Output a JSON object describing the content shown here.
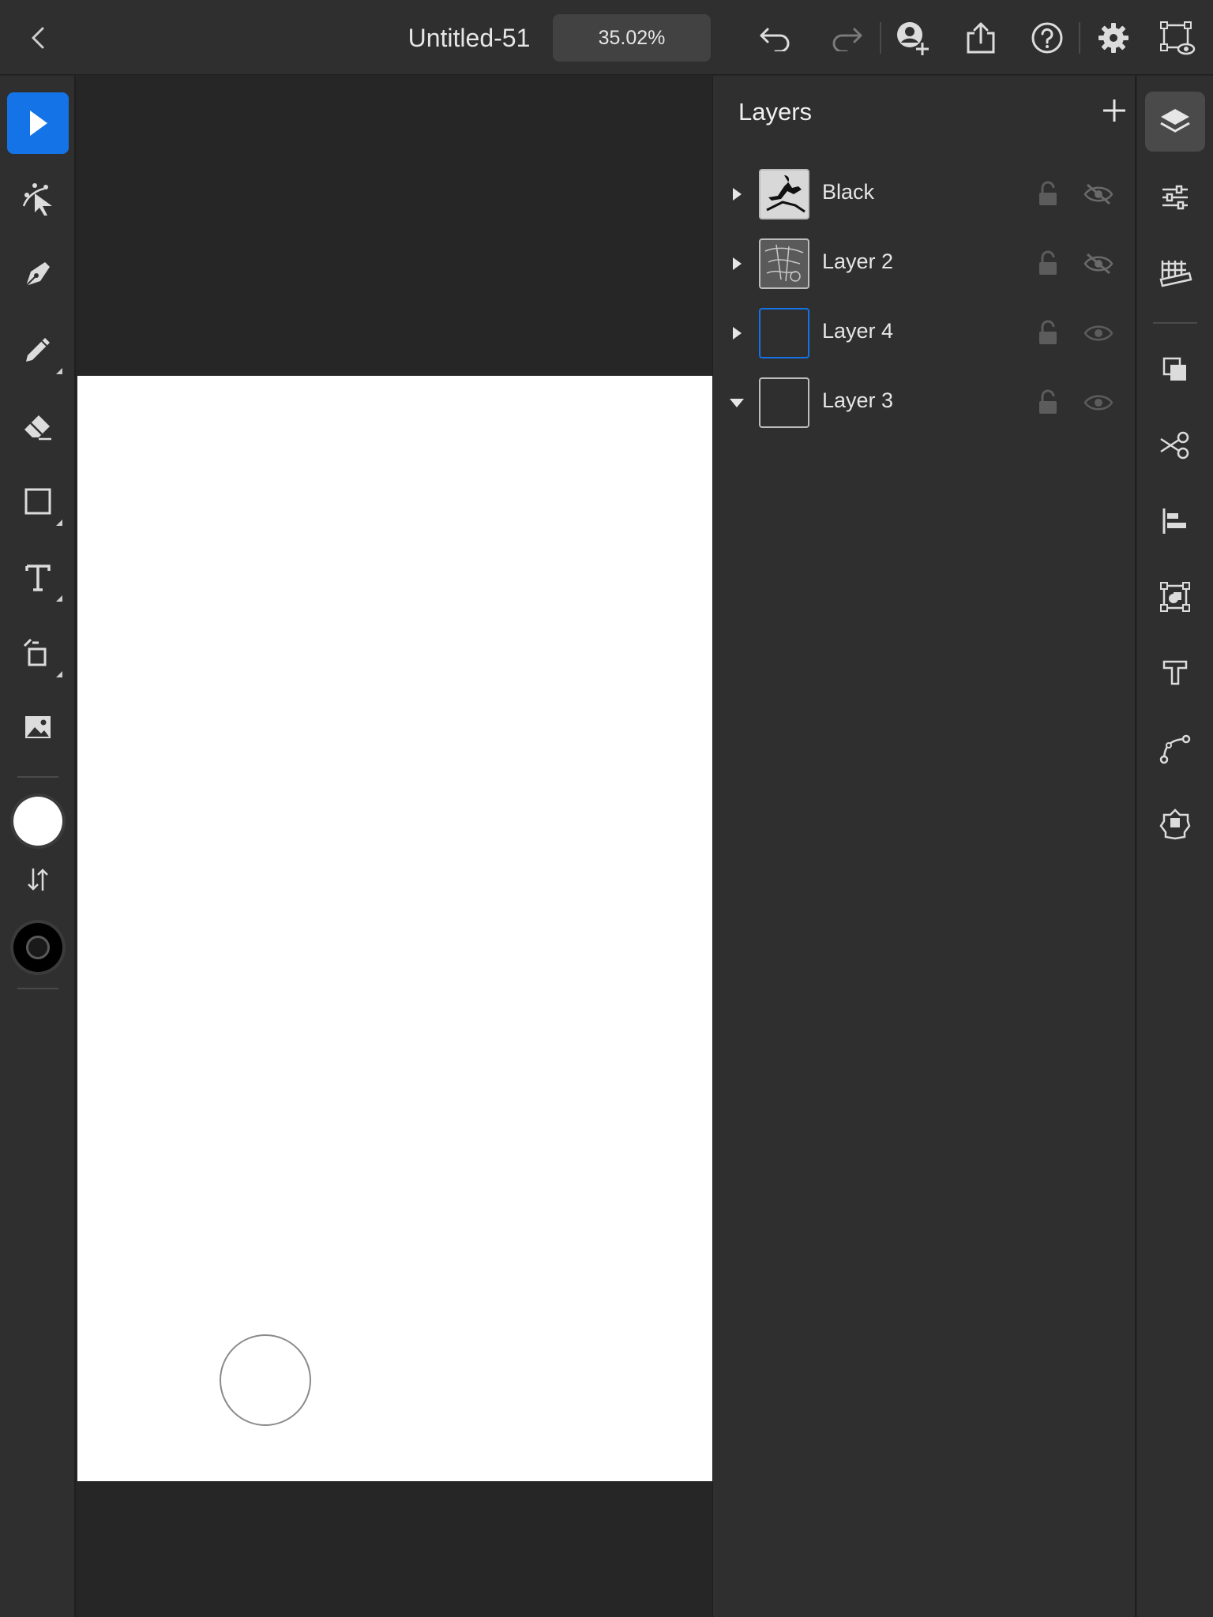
{
  "app": {
    "doc_title": "Untitled-51",
    "zoom": "35.02%"
  },
  "toolbar_icons": [
    "back-icon",
    "undo-icon",
    "redo-icon",
    "invite-user-icon",
    "share-icon",
    "help-icon",
    "settings-icon",
    "preview-icon"
  ],
  "left_tools": [
    "selection-tool",
    "direct-selection-tool",
    "pen-tool",
    "pencil-tool",
    "eraser-tool",
    "shape-tool",
    "type-tool",
    "transform-tool",
    "image-tool"
  ],
  "colors": {
    "fill": "#ffffff",
    "stroke": "#000000",
    "accent": "#1473e6"
  },
  "layers_panel": {
    "title": "Layers",
    "layers": [
      {
        "name": "Black",
        "expanded": false,
        "visible": false
      },
      {
        "name": "Layer 2",
        "expanded": false,
        "visible": false
      },
      {
        "name": "Layer 4",
        "expanded": false,
        "visible": true,
        "selected": true
      },
      {
        "name": "Layer 3",
        "expanded": true,
        "visible": true
      }
    ]
  },
  "right_rail": [
    "layers-icon",
    "properties-icon",
    "grid-icon",
    "boolean-icon",
    "scissors-icon",
    "align-icon",
    "repeat-icon",
    "character-icon",
    "path-icon",
    "effects-icon"
  ]
}
